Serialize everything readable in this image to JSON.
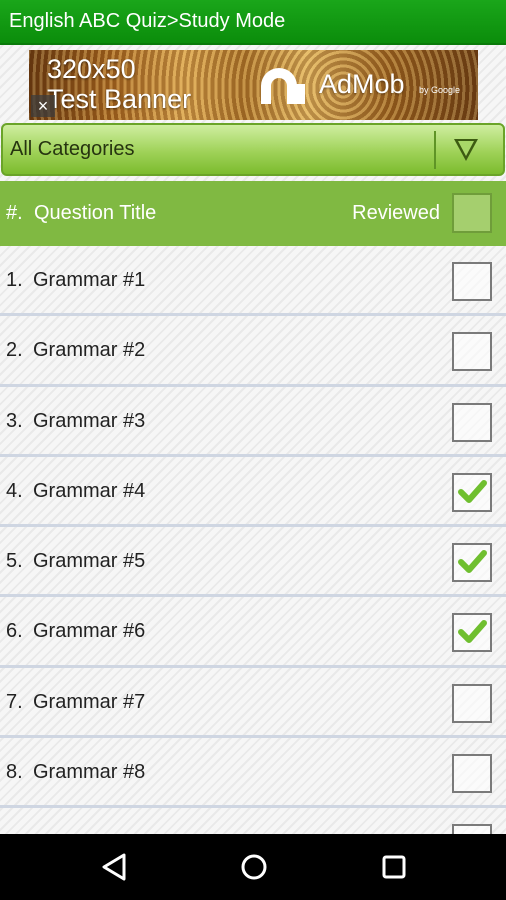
{
  "app": {
    "title": "English ABC Quiz>Study Mode"
  },
  "ad": {
    "size_text": "320x50",
    "label": "Test Banner",
    "brand": "AdMob",
    "brand_sub": "by Google",
    "close_glyph": "×",
    "logo_icon": "admob-logo"
  },
  "category_select": {
    "selected": "All Categories",
    "icon": "dropdown-arrow"
  },
  "list_header": {
    "number_label": "#.",
    "title_label": "Question Title",
    "reviewed_label": "Reviewed"
  },
  "rows": [
    {
      "num": "1.",
      "title": "Grammar #1",
      "reviewed": false
    },
    {
      "num": "2.",
      "title": "Grammar #2",
      "reviewed": false
    },
    {
      "num": "3.",
      "title": "Grammar #3",
      "reviewed": false
    },
    {
      "num": "4.",
      "title": "Grammar #4",
      "reviewed": true
    },
    {
      "num": "5.",
      "title": "Grammar #5",
      "reviewed": true
    },
    {
      "num": "6.",
      "title": "Grammar #6",
      "reviewed": true
    },
    {
      "num": "7.",
      "title": "Grammar #7",
      "reviewed": false
    },
    {
      "num": "8.",
      "title": "Grammar #8",
      "reviewed": false
    },
    {
      "num": "",
      "title": "",
      "reviewed": false
    }
  ],
  "navbar": {
    "back_icon": "back-triangle",
    "home_icon": "home-circle",
    "recents_icon": "recents-square"
  },
  "colors": {
    "appbar": "#0b8d0b",
    "header": "#80b942",
    "check": "#6fbf2f"
  }
}
